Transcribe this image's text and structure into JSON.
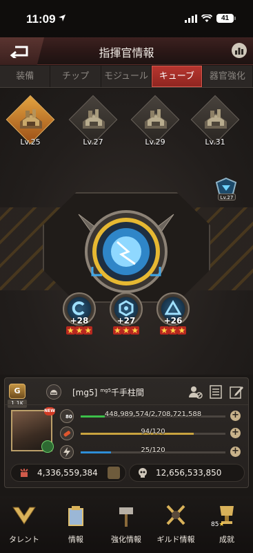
{
  "status": {
    "time": "11:09",
    "battery": "41"
  },
  "header": {
    "title": "指揮官情報"
  },
  "tabs": [
    {
      "label": "装備",
      "active": false
    },
    {
      "label": "チップ",
      "active": false
    },
    {
      "label": "モジュール",
      "active": false
    },
    {
      "label": "キューブ",
      "active": true
    },
    {
      "label": "器官強化",
      "active": false
    }
  ],
  "buildings": [
    {
      "level": "Lv.25",
      "active": true
    },
    {
      "level": "Lv.27",
      "active": false
    },
    {
      "level": "Lv.29",
      "active": false
    },
    {
      "level": "Lv.31",
      "active": false
    }
  ],
  "side_badge": {
    "level": "Lv.27"
  },
  "gems": [
    {
      "bonus": "+28",
      "stars": 3
    },
    {
      "bonus": "+27",
      "stars": 3
    },
    {
      "bonus": "+26",
      "stars": 3
    }
  ],
  "profile": {
    "rank": "1.1K",
    "name": "[mg5]",
    "name_tag": "mg5",
    "name_rest": "千手柱間",
    "portrait_badge": "NEW",
    "level": "80",
    "exp": {
      "text": "448,989,574/2,708,721,588",
      "fraction": 0.166
    },
    "stamina": {
      "text": "94/120",
      "fraction": 0.783
    },
    "energy": {
      "text": "25/120",
      "fraction": 0.208
    },
    "power": "4,336,559,384",
    "kills": "12,656,533,850"
  },
  "nav": [
    {
      "label": "タレント"
    },
    {
      "label": "情報"
    },
    {
      "label": "強化情報"
    },
    {
      "label": "ギルド情報"
    },
    {
      "label": "成就",
      "points": "85"
    }
  ],
  "colors": {
    "accent": "#b8362f",
    "exp_bar": "#3cc14a",
    "stamina_bar": "#c9a33f",
    "energy_bar": "#2e8ed6"
  }
}
